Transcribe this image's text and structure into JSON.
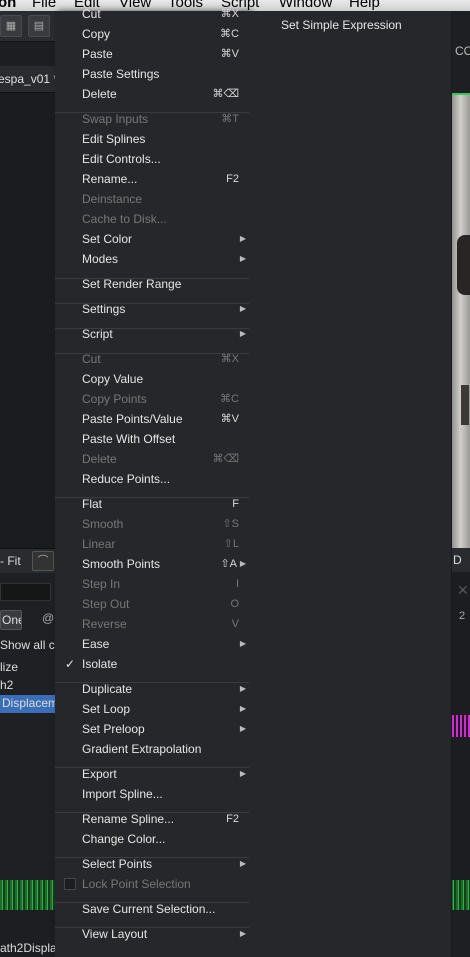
{
  "menubar": {
    "items": [
      "on",
      "File",
      "Edit",
      "View",
      "Tools",
      "Script",
      "Window",
      "Help"
    ]
  },
  "toolbar": {
    "grid_icon": "grid-icon",
    "save_icon": "floppy-icon"
  },
  "background": {
    "tab_label": "espa_v01 *",
    "right_header": "CO",
    "fit_label": "- Fit",
    "fit_curve_icon": "curve-icon",
    "right_d_label": "D",
    "one_button": "One",
    "show_all": "Show all co",
    "tree_items": [
      "lize",
      "h2",
      "Displacem"
    ],
    "bottom_label": "ath2Displa",
    "right_number": "2"
  },
  "menu": {
    "items": [
      {
        "label": "Cut",
        "shortcut": "⌘X",
        "disabled": false
      },
      {
        "label": "Copy",
        "shortcut": "⌘C",
        "disabled": false
      },
      {
        "label": "Paste",
        "shortcut": "⌘V",
        "disabled": false
      },
      {
        "label": "Paste Settings",
        "shortcut": "",
        "disabled": false
      },
      {
        "label": "Delete",
        "shortcut": "⌘⌫",
        "disabled": false
      },
      {
        "sep": true
      },
      {
        "label": "Swap Inputs",
        "shortcut": "⌘T",
        "disabled": true
      },
      {
        "label": "Edit Splines",
        "shortcut": "",
        "disabled": false
      },
      {
        "label": "Edit Controls...",
        "shortcut": "",
        "disabled": false
      },
      {
        "label": "Rename...",
        "shortcut": "F2",
        "disabled": false
      },
      {
        "label": "Deinstance",
        "shortcut": "",
        "disabled": true
      },
      {
        "label": "Cache to Disk...",
        "shortcut": "",
        "disabled": true
      },
      {
        "label": "Set Color",
        "shortcut": "",
        "disabled": false,
        "submenu": true
      },
      {
        "label": "Modes",
        "shortcut": "",
        "disabled": false,
        "submenu": true
      },
      {
        "sep": true
      },
      {
        "label": "Set Render Range",
        "shortcut": "",
        "disabled": false
      },
      {
        "sep": true
      },
      {
        "label": "Settings",
        "shortcut": "",
        "disabled": false,
        "submenu": true
      },
      {
        "sep": true
      },
      {
        "label": "Script",
        "shortcut": "",
        "disabled": false,
        "submenu": true
      },
      {
        "sep": true
      },
      {
        "label": "Cut",
        "shortcut": "⌘X",
        "disabled": true
      },
      {
        "label": "Copy Value",
        "shortcut": "",
        "disabled": false
      },
      {
        "label": "Copy Points",
        "shortcut": "⌘C",
        "disabled": true
      },
      {
        "label": "Paste Points/Value",
        "shortcut": "⌘V",
        "disabled": false
      },
      {
        "label": "Paste With Offset",
        "shortcut": "",
        "disabled": false
      },
      {
        "label": "Delete",
        "shortcut": "⌘⌫",
        "disabled": true
      },
      {
        "label": "Reduce Points...",
        "shortcut": "",
        "disabled": false
      },
      {
        "sep": true
      },
      {
        "label": "Flat",
        "shortcut": "F",
        "disabled": false
      },
      {
        "label": "Smooth",
        "shortcut": "⇧S",
        "disabled": true
      },
      {
        "label": "Linear",
        "shortcut": "⇧L",
        "disabled": true
      },
      {
        "label": "Smooth Points",
        "shortcut": "⇧A",
        "disabled": false,
        "submenu": true
      },
      {
        "label": "Step In",
        "shortcut": "I",
        "disabled": true
      },
      {
        "label": "Step Out",
        "shortcut": "O",
        "disabled": true
      },
      {
        "label": "Reverse",
        "shortcut": "V",
        "disabled": true
      },
      {
        "label": "Ease",
        "shortcut": "",
        "disabled": false,
        "submenu": true
      },
      {
        "label": "Isolate",
        "shortcut": "",
        "disabled": false,
        "checked": true
      },
      {
        "sep": true
      },
      {
        "label": "Duplicate",
        "shortcut": "",
        "disabled": false,
        "submenu": true
      },
      {
        "label": "Set Loop",
        "shortcut": "",
        "disabled": false,
        "submenu": true
      },
      {
        "label": "Set Preloop",
        "shortcut": "",
        "disabled": false,
        "submenu": true
      },
      {
        "label": "Gradient Extrapolation",
        "shortcut": "",
        "disabled": false
      },
      {
        "sep": true
      },
      {
        "label": "Export",
        "shortcut": "",
        "disabled": false,
        "submenu": true
      },
      {
        "label": "Import Spline...",
        "shortcut": "",
        "disabled": false
      },
      {
        "sep": true
      },
      {
        "label": "Rename Spline...",
        "shortcut": "F2",
        "disabled": false
      },
      {
        "label": "Change Color...",
        "shortcut": "",
        "disabled": false
      },
      {
        "sep": true
      },
      {
        "label": "Select Points",
        "shortcut": "",
        "disabled": false,
        "submenu": true
      },
      {
        "label": "Lock Point Selection",
        "shortcut": "",
        "disabled": true,
        "checkbox": true
      },
      {
        "sep": true
      },
      {
        "label": "Save Current Selection...",
        "shortcut": "",
        "disabled": false
      },
      {
        "sep": true
      },
      {
        "label": "View Layout",
        "shortcut": "",
        "disabled": false,
        "submenu": true
      }
    ]
  },
  "submenu": {
    "items": [
      "Set Simple Expression"
    ]
  },
  "colors": {
    "menu_bg": "#26272b",
    "selection_blue": "#3a6fb8",
    "viewer_border_green": "#31c85a",
    "spline_magenta": "#d22ad2"
  }
}
